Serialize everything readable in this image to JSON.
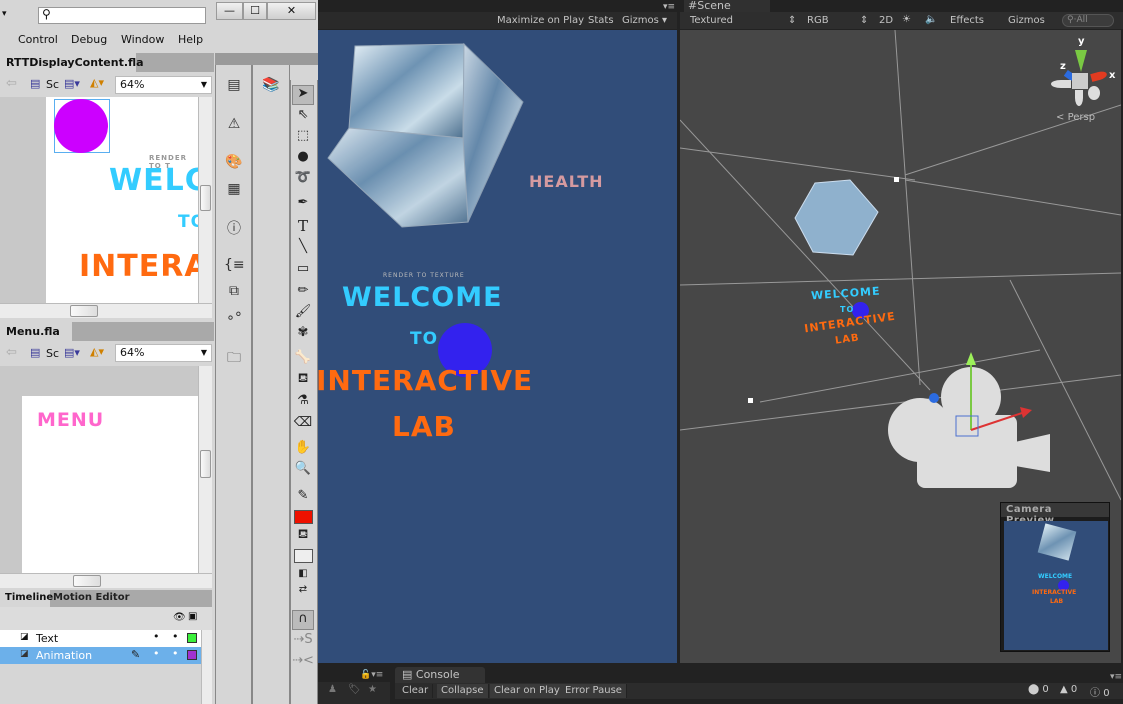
{
  "flash": {
    "search_placeholder": "",
    "window_buttons": {
      "minimize": "—",
      "maximize": "☐",
      "close": "✕"
    },
    "menu": [
      "Control",
      "Debug",
      "Window",
      "Help"
    ],
    "doc1": {
      "tab": "RTTDisplayContent.fla",
      "close": "×",
      "scene_label": "Sc",
      "zoom": "64%",
      "stage_text": {
        "render": "RENDER TO T",
        "welcome": "WELC",
        "to": "TO",
        "interactive": "INTERA"
      }
    },
    "doc2": {
      "tab": "Menu.fla",
      "close": "×",
      "scene_label": "Sc",
      "zoom": "64%",
      "stage_text": {
        "menu": "MENU"
      }
    },
    "timeline": {
      "tabs": [
        "Timeline",
        "Motion Editor"
      ],
      "layers": [
        {
          "name": "Text",
          "color": "#3cf03c",
          "selected": false
        },
        {
          "name": "Animation",
          "color": "#a030d0",
          "selected": true
        }
      ]
    },
    "tools_color": "#ee1100"
  },
  "unity": {
    "game_toolbar": [
      "Maximize on Play",
      "Stats",
      "Gizmos"
    ],
    "scene_tab": "Scene",
    "scene_toolbar": {
      "shading": "Textured",
      "render_mode": "RGB",
      "mode_2d": "2D",
      "effects": "Effects",
      "gizmos": "Gizmos",
      "search_placeholder": "All"
    },
    "game": {
      "health": "HEALTH",
      "render": "RENDER TO TEXTURE",
      "welcome": "WELCOME",
      "to": "TO",
      "interactive": "INTERACTIVE",
      "lab": "LAB"
    },
    "gizmo": {
      "y": "y",
      "x": "x",
      "z": "z",
      "projection": "Persp"
    },
    "scene_text": {
      "welcome": "WELCOME",
      "to": "TO",
      "interactive": "INTERACTIVE",
      "lab": "LAB"
    },
    "camera_preview": {
      "title": "Camera Preview",
      "welcome": "WELCOME",
      "interactive": "INTERACTIVE",
      "lab": "LAB"
    },
    "console": {
      "tab": "Console",
      "buttons": [
        "Clear",
        "Collapse",
        "Clear on Play",
        "Error Pause"
      ],
      "counts": {
        "errors": "0",
        "warnings": "0",
        "info": "0"
      }
    },
    "colors": {
      "game_bg": "#314d79",
      "cyan": "#33ccff",
      "orange": "#ff6a10",
      "pink": "#d59aa0",
      "ball": "#3322ee"
    }
  }
}
